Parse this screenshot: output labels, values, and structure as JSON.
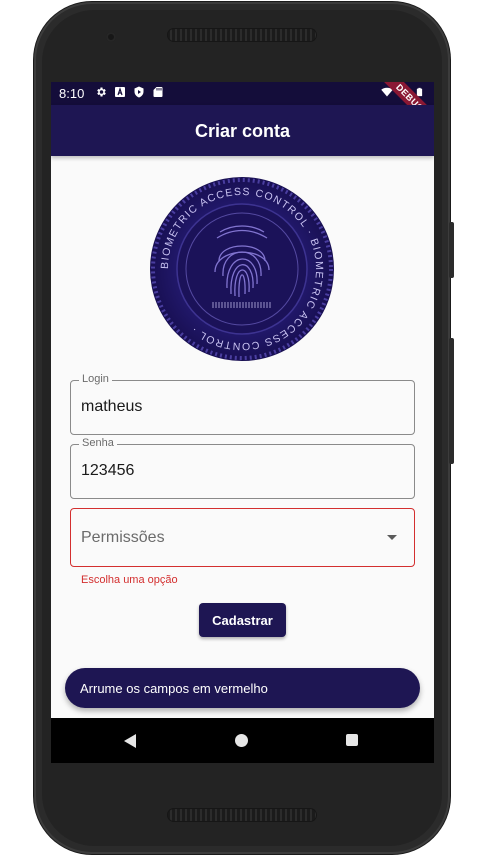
{
  "status_bar": {
    "time": "8:10",
    "icons_left": [
      "settings-icon",
      "a-icon",
      "shield-play-icon",
      "sd-card-icon"
    ],
    "icons_right": [
      "wifi-icon",
      "signal-icon",
      "battery-icon"
    ],
    "debug_label": "DEBUG"
  },
  "app_bar": {
    "title": "Criar conta"
  },
  "logo": {
    "ring_text": "BIOMETRIC ACCESS CONTROL · BIOMETRIC ACCESS CONTROL ·",
    "icon": "fingerprint-icon"
  },
  "form": {
    "login": {
      "label": "Login",
      "value": "matheus"
    },
    "password": {
      "label": "Senha",
      "value": "123456"
    },
    "permissions": {
      "placeholder": "Permissões",
      "error": "Escolha uma opção"
    },
    "submit_label": "Cadastrar"
  },
  "snackbar": {
    "message": "Arrume os campos em vermelho"
  },
  "nav_bar": {
    "back": "back-icon",
    "home": "home-icon",
    "recents": "recents-icon"
  },
  "colors": {
    "primary": "#1e1653",
    "status_bar": "#140d3a",
    "error": "#d32f2f",
    "debug_ribbon": "#8a1834",
    "background": "#fafafa"
  }
}
